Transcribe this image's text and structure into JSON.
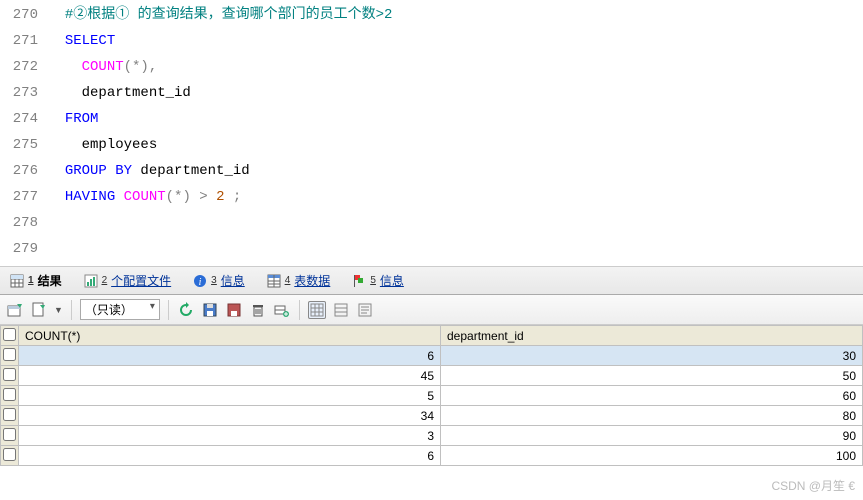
{
  "editor": {
    "lines": [
      {
        "num": "270",
        "tokens": [
          [
            "  ",
            "pad"
          ],
          [
            "#②根据① 的查询结果，查询哪个部门的员工个数>2",
            "c-comment"
          ]
        ]
      },
      {
        "num": "271",
        "tokens": [
          [
            "  ",
            "pad"
          ],
          [
            "SELECT",
            "c-keyword"
          ]
        ]
      },
      {
        "num": "272",
        "tokens": [
          [
            "    ",
            "pad"
          ],
          [
            "COUNT",
            "c-func"
          ],
          [
            "(*),",
            "c-op"
          ]
        ]
      },
      {
        "num": "273",
        "tokens": [
          [
            "    ",
            "pad"
          ],
          [
            "department_id",
            "c-text"
          ]
        ]
      },
      {
        "num": "274",
        "tokens": [
          [
            "  ",
            "pad"
          ],
          [
            "FROM",
            "c-keyword"
          ]
        ]
      },
      {
        "num": "275",
        "tokens": [
          [
            "    ",
            "pad"
          ],
          [
            "employees",
            "c-text"
          ]
        ]
      },
      {
        "num": "276",
        "tokens": [
          [
            "  ",
            "pad"
          ],
          [
            "GROUP BY",
            "c-keyword"
          ],
          [
            " department_id",
            "c-text"
          ]
        ]
      },
      {
        "num": "277",
        "tokens": [
          [
            "  ",
            "pad"
          ],
          [
            "HAVING",
            "c-keyword"
          ],
          [
            " ",
            "pad"
          ],
          [
            "COUNT",
            "c-func"
          ],
          [
            "(*) ",
            "c-op"
          ],
          [
            "> ",
            "c-op"
          ],
          [
            "2",
            "c-num"
          ],
          [
            " ;",
            "c-op"
          ]
        ]
      },
      {
        "num": "278",
        "tokens": []
      },
      {
        "num": "279",
        "tokens": []
      }
    ]
  },
  "tabs": {
    "results": {
      "num": "1",
      "label": "结果"
    },
    "profile": {
      "num": "2",
      "label": "个配置文件"
    },
    "info": {
      "num": "3",
      "label": "信息"
    },
    "table": {
      "num": "4",
      "label": "表数据"
    },
    "msg": {
      "num": "5",
      "label": "信息"
    }
  },
  "toolbar": {
    "mode_label": "（只读）",
    "mode_arrow": "▾"
  },
  "grid": {
    "columns": [
      "COUNT(*)",
      "department_id"
    ],
    "rows": [
      [
        "6",
        "30"
      ],
      [
        "45",
        "50"
      ],
      [
        "5",
        "60"
      ],
      [
        "34",
        "80"
      ],
      [
        "3",
        "90"
      ],
      [
        "6",
        "100"
      ]
    ],
    "selected_row": 0
  },
  "watermark": "CSDN @月笙 €"
}
